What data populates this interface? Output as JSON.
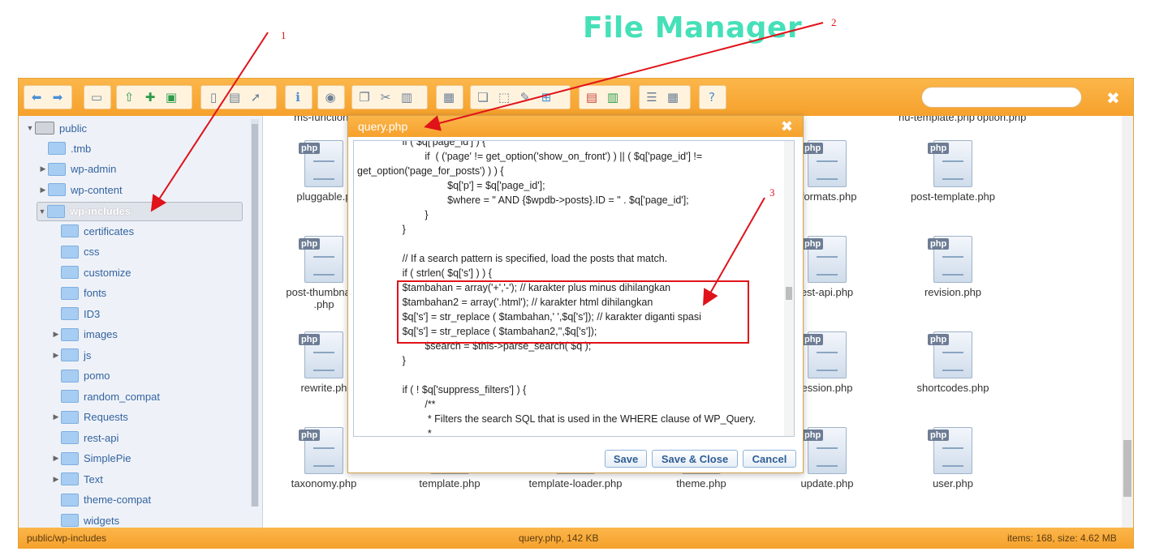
{
  "banner": {
    "title": "File Manager"
  },
  "tree": {
    "root": "public",
    "items": [
      {
        "label": ".tmb",
        "level": 1,
        "expandable": false
      },
      {
        "label": "wp-admin",
        "level": 1,
        "expandable": true
      },
      {
        "label": "wp-content",
        "level": 1,
        "expandable": true
      },
      {
        "label": "wp-includes",
        "level": 1,
        "expandable": true,
        "selected": true
      },
      {
        "label": "certificates",
        "level": 2,
        "expandable": false
      },
      {
        "label": "css",
        "level": 2,
        "expandable": false
      },
      {
        "label": "customize",
        "level": 2,
        "expandable": false
      },
      {
        "label": "fonts",
        "level": 2,
        "expandable": false
      },
      {
        "label": "ID3",
        "level": 2,
        "expandable": false
      },
      {
        "label": "images",
        "level": 2,
        "expandable": true
      },
      {
        "label": "js",
        "level": 2,
        "expandable": true
      },
      {
        "label": "pomo",
        "level": 2,
        "expandable": false
      },
      {
        "label": "random_compat",
        "level": 2,
        "expandable": false
      },
      {
        "label": "Requests",
        "level": 2,
        "expandable": true
      },
      {
        "label": "rest-api",
        "level": 2,
        "expandable": false
      },
      {
        "label": "SimplePie",
        "level": 2,
        "expandable": true
      },
      {
        "label": "Text",
        "level": 2,
        "expandable": true
      },
      {
        "label": "theme-compat",
        "level": 2,
        "expandable": false
      },
      {
        "label": "widgets",
        "level": 2,
        "expandable": false
      }
    ]
  },
  "files": {
    "top_row": [
      "ms-functions",
      "nu-template.php",
      "option.php"
    ],
    "icon_tag": "php",
    "grid": [
      [
        "pluggable.p",
        "",
        "",
        "",
        "-formats.php",
        "post-template.php"
      ],
      [
        "post-thumbnail-t\n.php",
        "",
        "",
        "",
        "est-api.php",
        "revision.php"
      ],
      [
        "rewrite.ph",
        "",
        "",
        "",
        "ession.php",
        "shortcodes.php"
      ],
      [
        "taxonomy.php",
        "template.php",
        "template-loader.php",
        "theme.php",
        "update.php",
        "user.php"
      ]
    ]
  },
  "status": {
    "path": "public/wp-includes",
    "selected": "query.php, 142 KB",
    "summary": "items: 168, size: 4.62 MB"
  },
  "dialog": {
    "title": "query.php",
    "close": "✖",
    "code": [
      "                if ( $q['page_id'] ) {",
      "                        if  ( ('page' != get_option('show_on_front') ) || ( $q['page_id'] !=",
      "get_option('page_for_posts') ) ) {",
      "                                $q['p'] = $q['page_id'];",
      "                                $where = \" AND {$wpdb->posts}.ID = \" . $q['page_id'];",
      "                        }",
      "                }",
      "",
      "                // If a search pattern is specified, load the posts that match.",
      "                if ( strlen( $q['s'] ) ) {",
      "                $tambahan = array('+','-'); // karakter plus minus dihilangkan",
      "                $tambahan2 = array('.html'); // karakter html dihilangkan",
      "                $q['s'] = str_replace ( $tambahan,' ',$q['s']); // karakter diganti spasi",
      "                $q['s'] = str_replace ( $tambahan2,'',$q['s']);",
      "                        $search = $this->parse_search( $q );",
      "                }",
      "",
      "                if ( ! $q['suppress_filters'] ) {",
      "                        /**",
      "                         * Filters the search SQL that is used in the WHERE clause of WP_Query.",
      "                         *"
    ],
    "buttons": {
      "save": "Save",
      "save_close": "Save & Close",
      "cancel": "Cancel"
    }
  },
  "annotations": {
    "one": "1",
    "two": "2",
    "three": "3"
  },
  "colors": {
    "accent": "#f6a12c",
    "annotation": "#e0121a",
    "banner": "#46e0b8"
  }
}
